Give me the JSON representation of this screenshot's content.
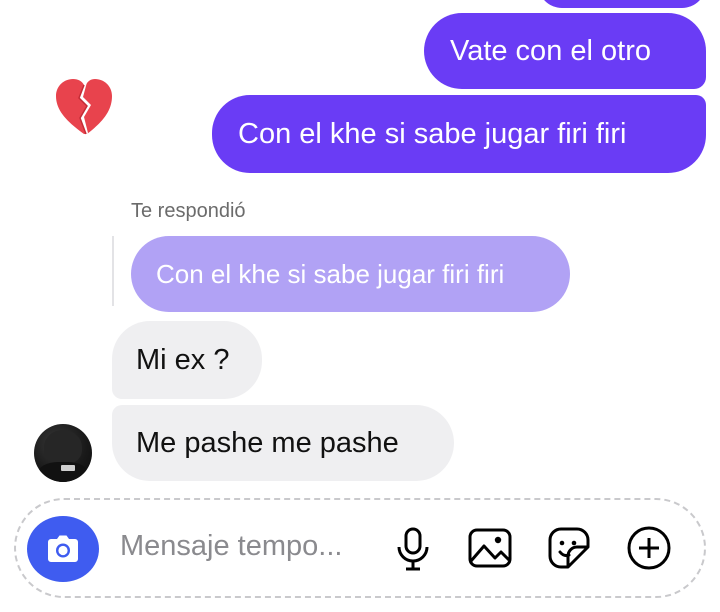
{
  "conversation": {
    "sent_messages": [
      {
        "text": ""
      },
      {
        "text": "Vate con el otro"
      },
      {
        "text": "Con el khe si sabe jugar firi firi"
      }
    ],
    "reaction": "💔",
    "reply": {
      "label": "Te respondió",
      "quoted_text": "Con el khe si sabe jugar firi firi"
    },
    "received_messages": [
      {
        "text": "Mi ex ?"
      },
      {
        "text": "Me pashe me pashe"
      }
    ]
  },
  "composer": {
    "placeholder": "Mensaje tempo...",
    "icons": [
      "camera-icon",
      "microphone-icon",
      "image-icon",
      "sticker-icon",
      "plus-circle-icon"
    ]
  },
  "colors": {
    "sent_bubble": "#6a3cf5",
    "quoted_bubble": "#b1a2f5",
    "received_bubble": "#efeff1",
    "camera_button": "#3f5cf0"
  }
}
